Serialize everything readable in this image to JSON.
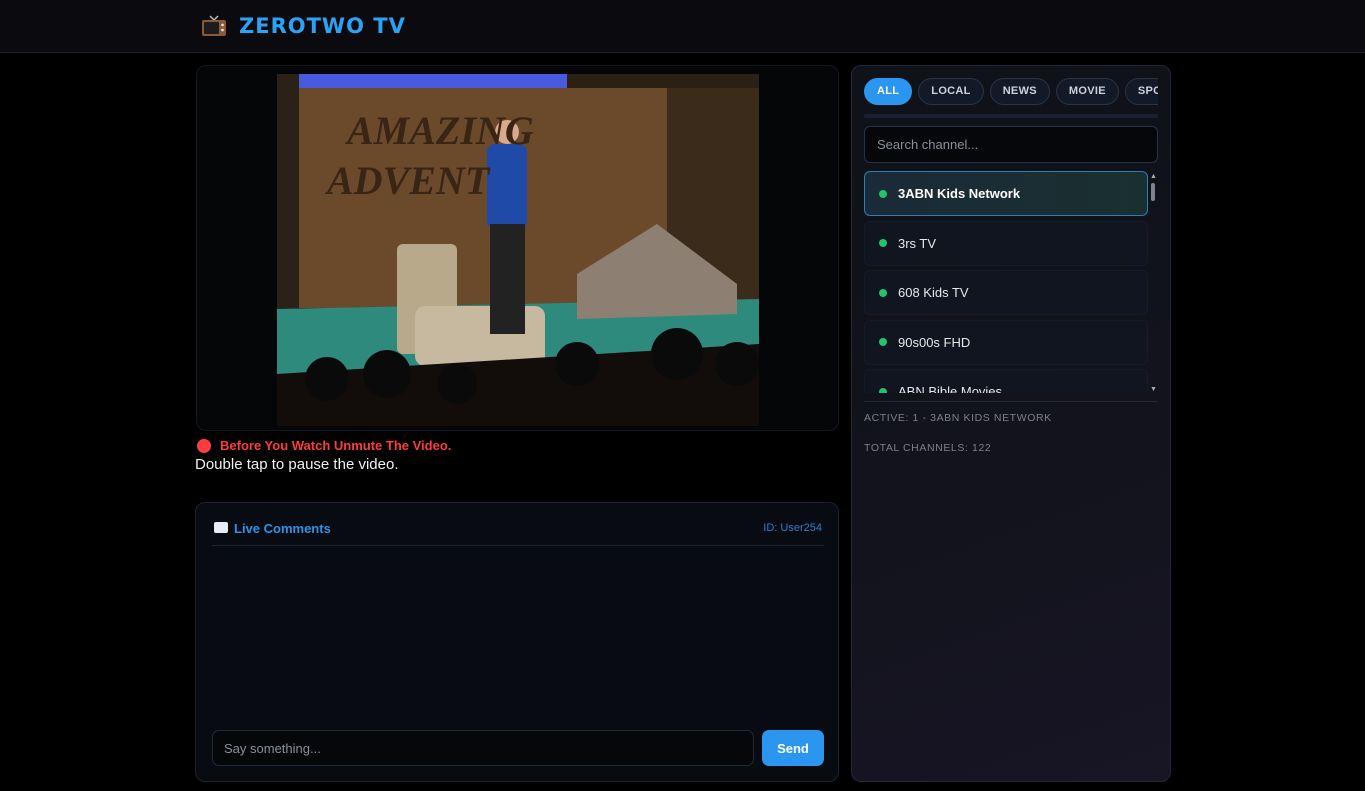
{
  "header": {
    "title": "ZEROTWO TV",
    "icon": "tv-icon"
  },
  "player": {
    "notice": "Before You Watch Unmute The Video.",
    "hint": "Double tap to pause the video."
  },
  "comments": {
    "title": "Live Comments",
    "user_id": "ID: User254",
    "placeholder": "Say something...",
    "send_label": "Send"
  },
  "sidebar": {
    "tabs": [
      {
        "label": "ALL",
        "active": true
      },
      {
        "label": "LOCAL",
        "active": false
      },
      {
        "label": "NEWS",
        "active": false
      },
      {
        "label": "MOVIE",
        "active": false
      },
      {
        "label": "SPORTS",
        "active": false
      }
    ],
    "search_placeholder": "Search channel...",
    "channels": [
      {
        "name": "3ABN Kids Network",
        "active": true
      },
      {
        "name": "3rs TV",
        "active": false
      },
      {
        "name": "608 Kids TV",
        "active": false
      },
      {
        "name": "90s00s FHD",
        "active": false
      },
      {
        "name": "ABN Bible Movies",
        "active": false
      }
    ],
    "active_text": "ACTIVE: 1 - 3ABN KIDS NETWORK",
    "total_text": "TOTAL CHANNELS: 122"
  },
  "colors": {
    "accent": "#2b96f0",
    "live_dot": "#23c26b",
    "warning": "#ff3b3b"
  }
}
